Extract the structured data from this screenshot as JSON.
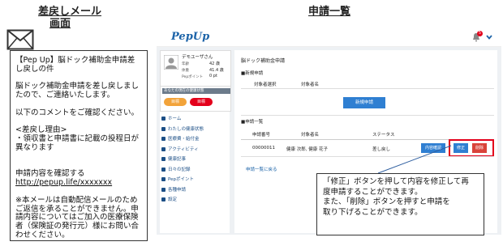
{
  "headings": {
    "left_line1": "差戻しメール",
    "left_line2": "画面",
    "right": "申請一覧"
  },
  "mail": {
    "lines": [
      "【Pep Up】脳ドック補助金申請差",
      "し戻しの件",
      "",
      "脳ドック補助金申請を差し戻しまし",
      "たので、ご連絡いたします。",
      "",
      "以下のコメントをご確認ください。",
      "",
      "<差戻し理由>",
      "・領収書と申請書に記載の投程日が",
      "異なります",
      "",
      "",
      "申請内容を確認する",
      "http://pepup.life/xxxxxxx",
      "",
      "※本メールは自動配信メールのため",
      "ご返信を承ることができません。申",
      "請内容についてはご加入の医療保険",
      "者（保険証の発行元）様にお問い合",
      "わせください。"
    ]
  },
  "app": {
    "logo": "PepUp",
    "notifications": "5",
    "user_name": "デモユーザさん",
    "profile_rows": [
      {
        "label": "年齢",
        "value": "42 歳"
      },
      {
        "label": "体重",
        "value": "41.4 歳"
      },
      {
        "label": "Pepポイント",
        "value": "0 pt"
      }
    ],
    "points_title": "あなたの現在の健康状態",
    "badges": [
      "目標",
      "目標"
    ],
    "nav": [
      "ホーム",
      "わたしの健康状態",
      "医療費・給付金",
      "アクティビティ",
      "健康記事",
      "日々の記録",
      "Pepポイント",
      "各種申請",
      "設定"
    ],
    "page_title": "脳ドック補助金申請",
    "new_section": "■新規申請",
    "new_cols": [
      "対象者選択",
      "対象者名"
    ],
    "new_button": "新規申請",
    "list_section": "■申請一覧",
    "list_cols": [
      "申請番号",
      "対象者名",
      "ステータス"
    ],
    "row": {
      "number": "00000011",
      "name": "健康 次郎, 健康 花子",
      "status": "差し戻し"
    },
    "row_buttons": [
      "内容確認",
      "修正",
      "削除"
    ],
    "back_link": "申請一覧に戻る"
  },
  "callout": {
    "lines": [
      "「修正」ボタンを押して内容を修正して再",
      "度申請することができます。",
      "また、「削除」ボタンを押すと申請を",
      "取り下げることができます。"
    ]
  },
  "colors": {
    "brand": "#1c63a8",
    "red": "#e3001b",
    "orange": "#f2a33a",
    "status_blue": "#2f7fd2"
  }
}
